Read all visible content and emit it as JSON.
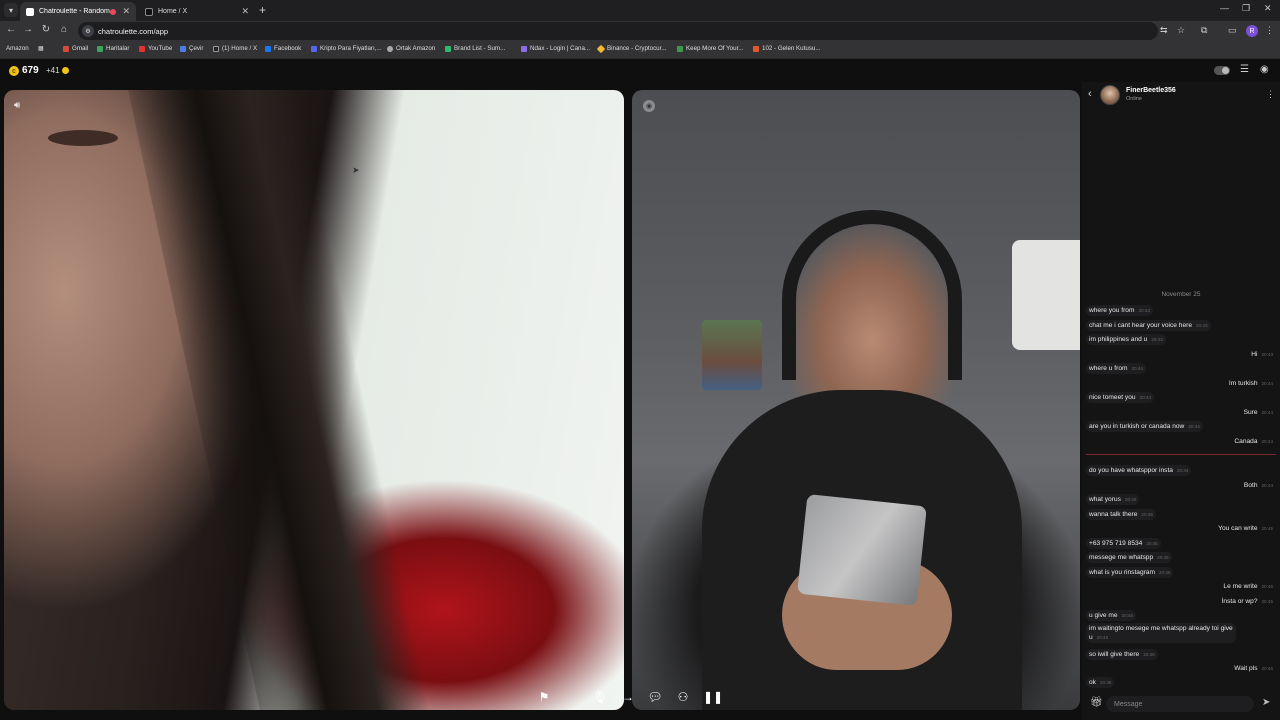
{
  "browser": {
    "tabs": [
      {
        "title": "Chatroulette - Random vid",
        "active": true,
        "recording": true
      },
      {
        "title": "Home / X",
        "active": false,
        "recording": false
      }
    ],
    "url": "chatroulette.com/app",
    "bookmarks": [
      "Amazon",
      "Gmail",
      "Haritalar",
      "YouTube",
      "Çevir",
      "(1) Home / X",
      "Facebook",
      "Kripto Para Fiyatları,...",
      "Ortak Amazon",
      "Brand List - Sum...",
      "Ndax - Login | Cana...",
      "Binance - Cryptocur...",
      "Keep More Of Your...",
      "102 - Gelen Kutusu..."
    ],
    "profile_initial": "R"
  },
  "app": {
    "coins": "679",
    "coins_bonus": "+41"
  },
  "chat": {
    "username": "FinerBeetle356",
    "status": "Online",
    "date_label": "November 25",
    "messages": [
      {
        "dir": "in",
        "text": "where you from",
        "time": "20:43"
      },
      {
        "dir": "in",
        "text": "chat me i cant hear your voice here",
        "time": "20:43"
      },
      {
        "dir": "in",
        "text": "im philippines and u",
        "time": "20:43"
      },
      {
        "dir": "out",
        "text": "Hi",
        "time": "20:43"
      },
      {
        "dir": "in",
        "text": "where u from",
        "time": "20:44"
      },
      {
        "dir": "out",
        "text": "Im turkish",
        "time": "20:44"
      },
      {
        "dir": "in",
        "text": "nice tomeet you",
        "time": "20:44"
      },
      {
        "dir": "out",
        "text": "Sure",
        "time": "20:44"
      },
      {
        "dir": "in",
        "text": "are you in turkish or canada now",
        "time": "20:44"
      },
      {
        "dir": "out",
        "text": "Canada",
        "time": "20:44"
      },
      {
        "dir": "in",
        "text": "do you have whatsppor insta",
        "time": "20:44"
      },
      {
        "dir": "out",
        "text": "Both",
        "time": "20:44"
      },
      {
        "dir": "in",
        "text": "what yorus",
        "time": "20:45"
      },
      {
        "dir": "in",
        "text": "wanna talk there",
        "time": "20:45"
      },
      {
        "dir": "out",
        "text": "You can write",
        "time": "20:45"
      },
      {
        "dir": "in",
        "text": "+63 975 719 8534",
        "time": "20:45"
      },
      {
        "dir": "in",
        "text": "messege me whatspp",
        "time": "20:45"
      },
      {
        "dir": "in",
        "text": "what is you rinstagram",
        "time": "20:45"
      },
      {
        "dir": "out",
        "text": "Le me write",
        "time": "20:45"
      },
      {
        "dir": "out",
        "text": "İnsta or wp?",
        "time": "20:45"
      },
      {
        "dir": "in",
        "text": "u give me",
        "time": "20:45"
      },
      {
        "dir": "in",
        "text": "im waitingto mesege me whatspp already toi give u",
        "time": "20:46"
      },
      {
        "dir": "in",
        "text": "so iwill give there",
        "time": "20:46"
      },
      {
        "dir": "out",
        "text": "Wait pls",
        "time": "20:46"
      },
      {
        "dir": "in",
        "text": "ok",
        "time": "20:46"
      }
    ],
    "input_placeholder": "Message"
  }
}
